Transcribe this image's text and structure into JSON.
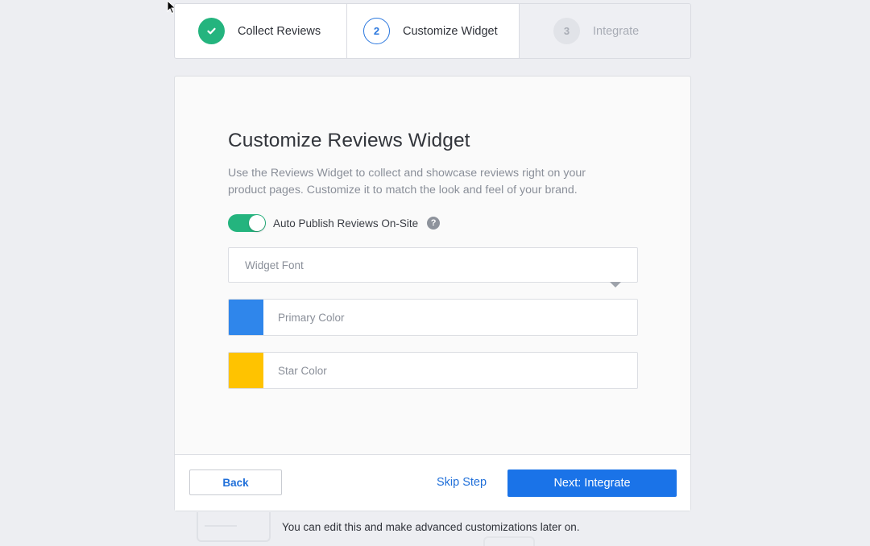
{
  "stepper": {
    "steps": [
      {
        "number": "",
        "label": "Collect Reviews",
        "state": "done"
      },
      {
        "number": "2",
        "label": "Customize Widget",
        "state": "active"
      },
      {
        "number": "3",
        "label": "Integrate",
        "state": "pending"
      }
    ]
  },
  "card": {
    "title": "Customize Reviews Widget",
    "description": "Use the Reviews Widget to collect and showcase reviews right on your product pages. Customize it to match the look and feel of your brand.",
    "toggle": {
      "label": "Auto Publish Reviews On-Site",
      "checked": true,
      "help": "?"
    },
    "font_field": {
      "placeholder": "Widget Font"
    },
    "primary_color": {
      "label": "Primary Color",
      "color": "#2f86eb"
    },
    "star_color": {
      "label": "Star Color",
      "color": "#ffc300"
    }
  },
  "footer": {
    "back_label": "Back",
    "skip_label": "Skip Step",
    "next_label": "Next: Integrate"
  },
  "note": "You can edit this and make advanced customizations later on.",
  "colors": {
    "accent": "#1a73e8",
    "success": "#24b47e"
  }
}
